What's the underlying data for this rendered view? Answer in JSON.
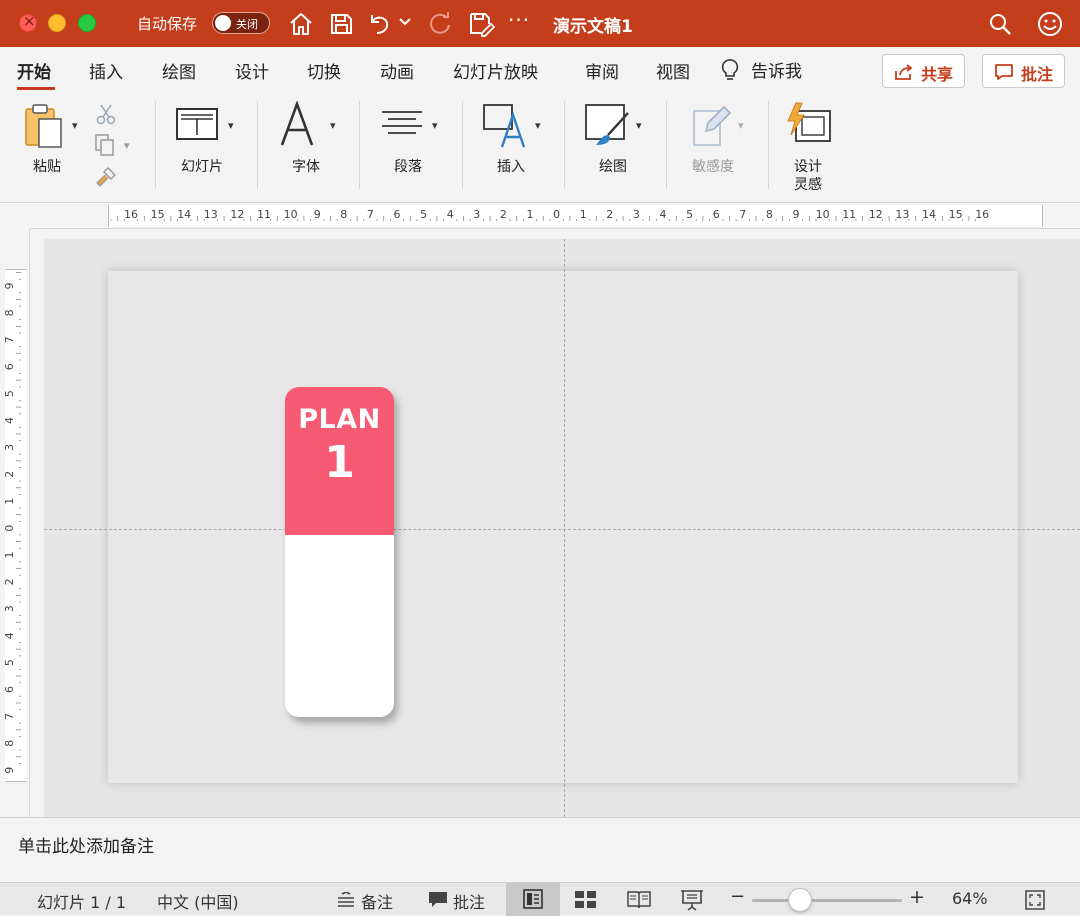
{
  "titlebar": {
    "autosave_label": "自动保存",
    "autosave_state": "关闭",
    "more": "···",
    "doc_title": "演示文稿1",
    "accent": "#c43e1c"
  },
  "tabs": {
    "items": [
      "开始",
      "插入",
      "绘图",
      "设计",
      "切换",
      "动画",
      "幻灯片放映",
      "审阅",
      "视图"
    ],
    "active": "开始",
    "tell_me": "告诉我",
    "share": "共享",
    "comments": "批注"
  },
  "ribbon": {
    "paste": "粘贴",
    "slides": "幻灯片",
    "font": "字体",
    "paragraph": "段落",
    "insert": "插入",
    "drawing": "绘图",
    "sensitivity": "敏感度",
    "design_ideas_1": "设计",
    "design_ideas_2": "灵感"
  },
  "rulers": {
    "h_labels": [
      "16",
      "15",
      "14",
      "13",
      "12",
      "11",
      "10",
      "9",
      "8",
      "7",
      "6",
      "5",
      "4",
      "3",
      "2",
      "1",
      "0",
      "1",
      "2",
      "3",
      "4",
      "5",
      "6",
      "7",
      "8",
      "9",
      "10",
      "11",
      "12",
      "13",
      "14",
      "15",
      "16"
    ],
    "v_labels": [
      "9",
      "8",
      "7",
      "6",
      "5",
      "4",
      "3",
      "2",
      "1",
      "0",
      "1",
      "2",
      "3",
      "4",
      "5",
      "6",
      "7",
      "8",
      "9"
    ]
  },
  "slide": {
    "plan_word": "PLAN",
    "plan_number": "1",
    "card_color": "#f75a73"
  },
  "notes": {
    "placeholder": "单击此处添加备注"
  },
  "status": {
    "slide_counter": "幻灯片 1 / 1",
    "language": "中文 (中国)",
    "notes_btn": "备注",
    "comments_btn": "批注",
    "zoom_minus": "−",
    "zoom_plus": "+",
    "zoom_level": "64%",
    "zoom_fraction": 0.3
  }
}
